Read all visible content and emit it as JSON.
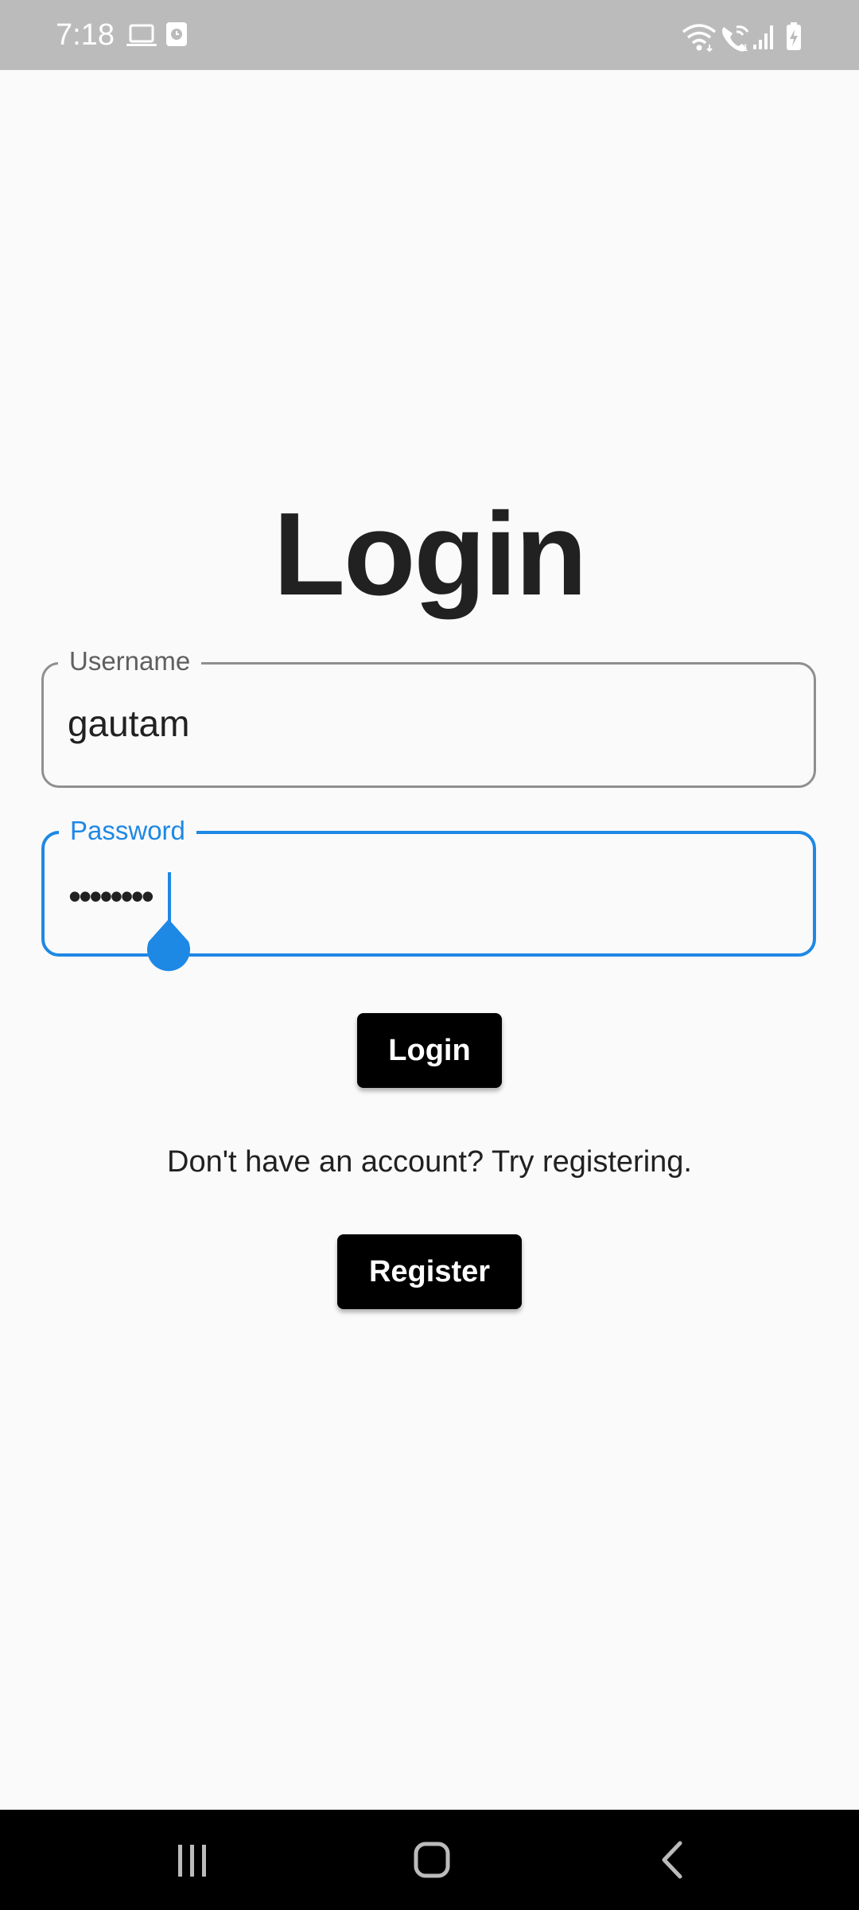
{
  "status_bar": {
    "time": "7:18",
    "left_icons": [
      "laptop-icon",
      "clock-notification-icon"
    ],
    "right_icons": [
      "wifi-icon",
      "wifi-calling-icon",
      "signal-icon",
      "battery-charging-icon"
    ]
  },
  "login_screen": {
    "title": "Login",
    "username": {
      "label": "Username",
      "value": "gautam"
    },
    "password": {
      "label": "Password",
      "masked_value": "••••••••"
    },
    "login_button": "Login",
    "register_prompt": "Don't have an account? Try registering.",
    "register_button": "Register"
  },
  "navigation_bar": {
    "buttons": [
      "recents-icon",
      "home-icon",
      "back-icon"
    ]
  },
  "colors": {
    "accent": "#1e88e5",
    "status_bar": "#bbbbbb",
    "background": "#fafafa",
    "button": "#000000",
    "nav_bar": "#000000"
  }
}
